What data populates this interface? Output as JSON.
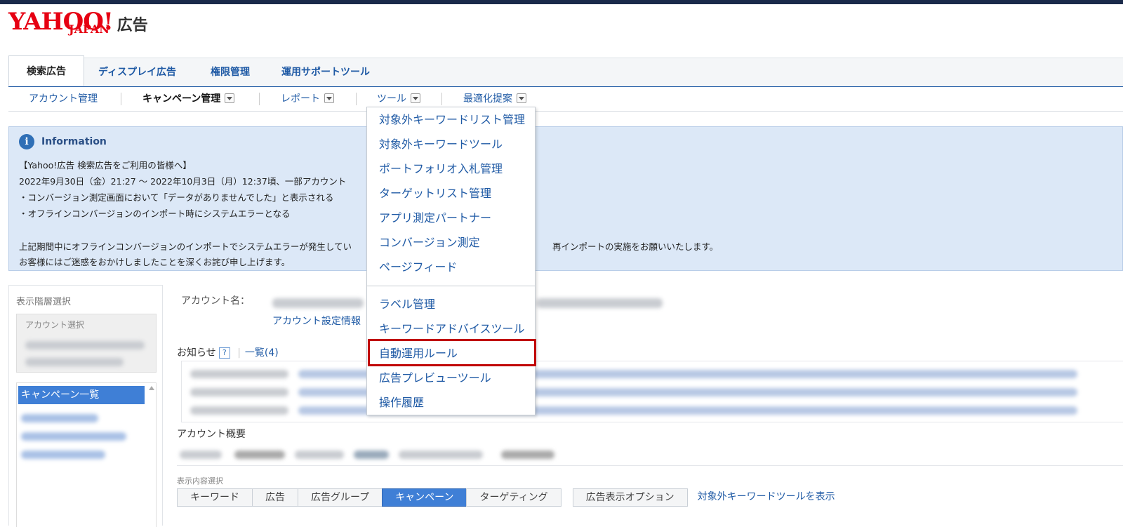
{
  "brand": {
    "logo_main": "YAHOO!",
    "logo_sub": "JAPAN",
    "product": "広告",
    "color": "#e60012"
  },
  "tabs": [
    {
      "label": "検索広告",
      "active": true
    },
    {
      "label": "ディスプレイ広告"
    },
    {
      "label": "権限管理"
    },
    {
      "label": "運用サポートツール"
    }
  ],
  "subnav": [
    {
      "label": "アカウント管理"
    },
    {
      "label": "キャンペーン管理"
    },
    {
      "label": "レポート"
    },
    {
      "label": "ツール"
    },
    {
      "label": "最適化提案"
    }
  ],
  "info": {
    "icon": "i",
    "title": "Information",
    "lines": [
      "【Yahoo!広告 検索広告をご利用の皆様へ】",
      "2022年9月30日（金）21:27 ～ 2022年10月3日（月）12:37頃、一部アカウント",
      "・コンバージョン測定画面において「データがありませんでした」と表示される",
      "・オフラインコンバージョンのインポート時にシステムエラーとなる",
      "上記期間中にオフラインコンバージョンのインポートでシステムエラーが発生してい",
      "再インポートの実施をお願いいたします。",
      "お客様にはご迷惑をおかけしましたことを深くお詫び申し上げます。"
    ]
  },
  "left_panel": {
    "title": "表示階層選択",
    "account_select": "アカウント選択",
    "campaign_list": "キャンペーン一覧"
  },
  "main": {
    "account_name_label": "アカウント名：",
    "account_settings_link": "アカウント設定情報",
    "notice_label": "お知らせ",
    "help_mark": "?",
    "list_link": "一覧(4)",
    "overview_label": "アカウント概要",
    "view_select_label": "表示内容選択",
    "view_tabs": [
      "キーワード",
      "広告",
      "広告グループ",
      "キャンペーン",
      "ターゲティング"
    ],
    "ad_display_option": "広告表示オプション",
    "negative_keyword_link": "対象外キーワードツールを表示"
  },
  "tools_menu": {
    "items_group1": [
      "対象外キーワードリスト管理",
      "対象外キーワードツール",
      "ポートフォリオ入札管理",
      "ターゲットリスト管理",
      "アプリ測定パートナー",
      "コンバージョン測定",
      "ページフィード"
    ],
    "items_group2": [
      "ラベル管理",
      "キーワードアドバイスツール",
      "自動運用ルール",
      "広告プレビューツール",
      "操作履歴"
    ],
    "highlight_color": "#c00000"
  }
}
